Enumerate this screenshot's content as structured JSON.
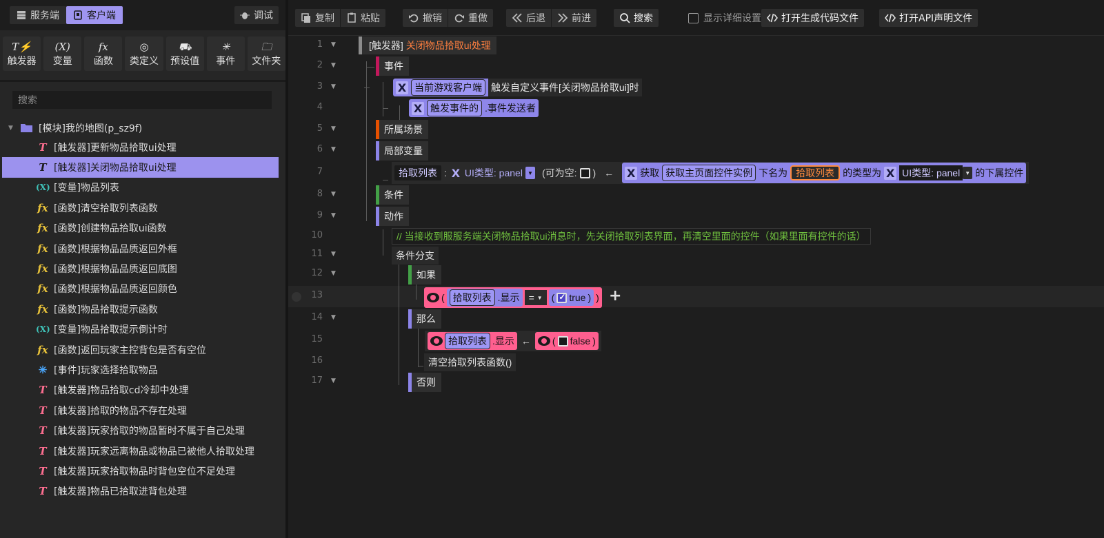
{
  "left": {
    "tabs": {
      "server": "服务端",
      "client": "客户端"
    },
    "debug_label": "调试",
    "toolbox": [
      {
        "icon": "T⚡",
        "label": "触发器"
      },
      {
        "icon": "(X)",
        "label": "变量"
      },
      {
        "icon": "fx",
        "label": "函数"
      },
      {
        "icon": "◎",
        "label": "类定义"
      },
      {
        "icon": "⛟",
        "label": "预设值"
      },
      {
        "icon": "✳",
        "label": "事件"
      },
      {
        "icon": "🗀",
        "label": "文件夹"
      }
    ],
    "search_placeholder": "搜索",
    "root_label": "[模块]我的地图(p_sz9f)",
    "items": [
      {
        "type": "trigger",
        "label": "[触发器]更新物品拾取ui处理"
      },
      {
        "type": "trigger",
        "label": "[触发器]关闭物品拾取ui处理"
      },
      {
        "type": "var",
        "label": "[变量]物品列表"
      },
      {
        "type": "func",
        "label": "[函数]清空拾取列表函数"
      },
      {
        "type": "func",
        "label": "[函数]创建物品拾取ui函数"
      },
      {
        "type": "func",
        "label": "[函数]根据物品品质返回外框"
      },
      {
        "type": "func",
        "label": "[函数]根据物品品质返回底图"
      },
      {
        "type": "func",
        "label": "[函数]根据物品品质返回颜色"
      },
      {
        "type": "func",
        "label": "[函数]物品拾取提示函数"
      },
      {
        "type": "var",
        "label": "[变量]物品拾取提示倒计时"
      },
      {
        "type": "func",
        "label": "[函数]返回玩家主控背包是否有空位"
      },
      {
        "type": "event",
        "label": "[事件]玩家选择拾取物品"
      },
      {
        "type": "trigger",
        "label": "[触发器]物品拾取cd冷却中处理"
      },
      {
        "type": "trigger",
        "label": "[触发器]拾取的物品不存在处理"
      },
      {
        "type": "trigger",
        "label": "[触发器]玩家拾取的物品暂时不属于自己处理"
      },
      {
        "type": "trigger",
        "label": "[触发器]玩家远离物品或物品已被他人拾取处理"
      },
      {
        "type": "trigger",
        "label": "[触发器]玩家拾取物品时背包空位不足处理"
      },
      {
        "type": "trigger",
        "label": "[触发器]物品已拾取进背包处理"
      }
    ],
    "selected_index": 1
  },
  "toolbar": {
    "copy": "复制",
    "paste": "粘贴",
    "undo": "撤销",
    "redo": "重做",
    "back": "后退",
    "forward": "前进",
    "search": "搜索",
    "detail_toggle": "显示详细设置",
    "open_code": "打开生成代码文件",
    "open_api": "打开API声明文件"
  },
  "editor": {
    "line_numbers": [
      "1",
      "2",
      "3",
      "4",
      "5",
      "6",
      "7",
      "8",
      "9",
      "10",
      "11",
      "12",
      "13",
      "14",
      "15",
      "16",
      "17"
    ],
    "l1": {
      "prefix": "[触发器]",
      "name": "关闭物品拾取ui处理"
    },
    "l2": "事件",
    "l3": {
      "chip": "当前游戏客户端",
      "text": "触发自定义事件[关闭物品拾取ui]时"
    },
    "l4": {
      "chip": "触发事件的",
      "text": ".事件发送者"
    },
    "l5": "所属场景",
    "l6": "局部变量",
    "l7": {
      "var_name": "拾取列表",
      "colon": ":",
      "type": "UI类型: panel",
      "nullable": "(可为空:",
      "nullable_close": ")",
      "assign": "←",
      "get": "获取",
      "chip": "获取主页面控件实例",
      "under_name": "下名为",
      "name_value": "拾取列表",
      "type_is": "的类型为",
      "type2": "UI类型: panel",
      "suffix": "的下属控件"
    },
    "l8": "条件",
    "l9": "动作",
    "l10": "// 当接收到服服务端关闭物品拾取ui消息时，先关闭拾取列表界面，再清空里面的控件（如果里面有控件的话）",
    "l11": "条件分支",
    "l12": "如果",
    "l13": {
      "open": "(",
      "var": "拾取列表",
      "prop": ".显示",
      "op": "=",
      "value": "true",
      "close": ")"
    },
    "l14": "那么",
    "l15": {
      "var": "拾取列表",
      "prop": ".显示",
      "assign": "←",
      "value": "false"
    },
    "l16": "清空拾取列表函数()",
    "l17": "否则"
  },
  "colors": {
    "accent": "#9c92ee",
    "trigger": "#ff6f91",
    "variable": "#3fc2b8",
    "function": "#e8c23a",
    "event": "#4aa8ff",
    "bool_block": "#ff5f8f",
    "comment": "#6fbf3e"
  }
}
